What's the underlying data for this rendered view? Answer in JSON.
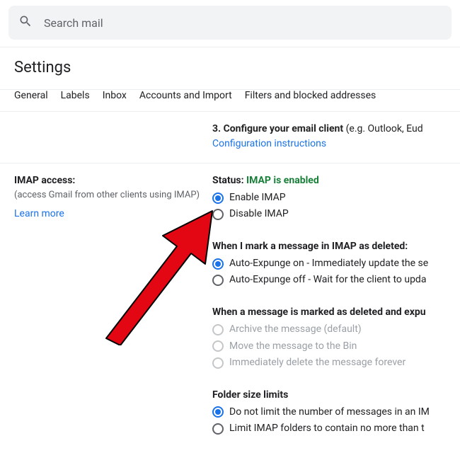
{
  "search": {
    "placeholder": "Search mail"
  },
  "pageTitle": "Settings",
  "tabs": [
    "General",
    "Labels",
    "Inbox",
    "Accounts and Import",
    "Filters and blocked addresses"
  ],
  "topSection": {
    "stepBold": "3. Configure your email client",
    "stepRest": " (e.g. Outlook, Eud",
    "link": "Configuration instructions"
  },
  "imapLeft": {
    "heading": "IMAP access:",
    "sub": "(access Gmail from other clients using IMAP)",
    "learnMore": "Learn more"
  },
  "status": {
    "label": "Status: ",
    "value": "IMAP is enabled"
  },
  "imapRadios": {
    "enable": "Enable IMAP",
    "disable": "Disable IMAP"
  },
  "deleteGroup": {
    "heading": "When I mark a message in IMAP as deleted:",
    "opt1": "Auto-Expunge on - Immediately update the se",
    "opt2": "Auto-Expunge off - Wait for the client to upda"
  },
  "expungeGroup": {
    "heading": "When a message is marked as deleted and expu",
    "opt1": "Archive the message (default)",
    "opt2": "Move the message to the Bin",
    "opt3": "Immediately delete the message forever"
  },
  "folderGroup": {
    "heading": "Folder size limits",
    "opt1": "Do not limit the number of messages in an IM",
    "opt2": "Limit IMAP folders to contain no more than t"
  }
}
